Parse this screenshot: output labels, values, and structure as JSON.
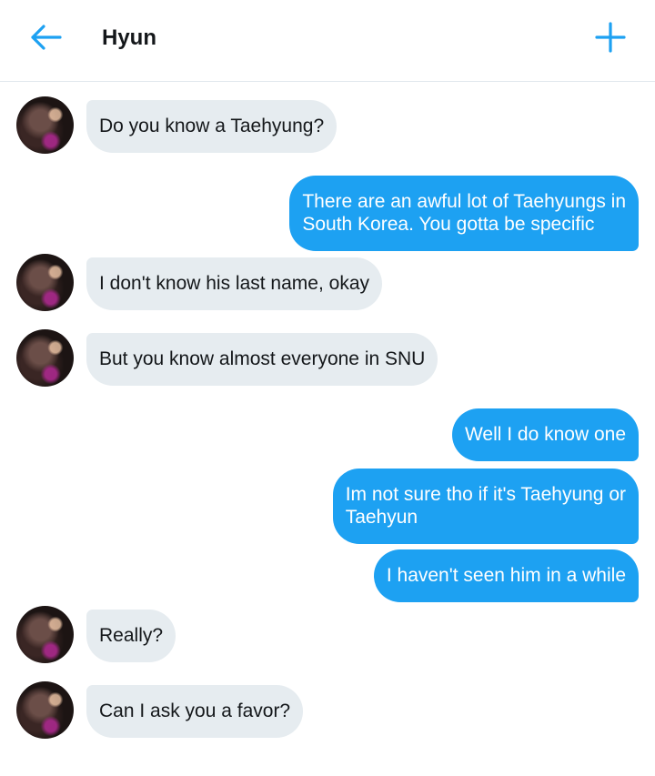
{
  "header": {
    "title": "Hyun",
    "back_icon": "arrow-left-icon",
    "add_icon": "plus-icon",
    "accent_color": "#1da1f2"
  },
  "messages": [
    {
      "direction": "incoming",
      "text": "Do you know a Taehyung?"
    },
    {
      "direction": "outgoing",
      "text": "There are an awful lot of Taehyungs in\nSouth Korea. You gotta be specific"
    },
    {
      "direction": "incoming",
      "text": "I don't know his last name, okay"
    },
    {
      "direction": "incoming",
      "text": "But you know almost everyone in SNU"
    },
    {
      "direction": "outgoing",
      "text": "Well I do know one"
    },
    {
      "direction": "outgoing",
      "text": "Im not sure tho if it's Taehyung or\nTaehyun"
    },
    {
      "direction": "outgoing",
      "text": "I haven't seen him in a while"
    },
    {
      "direction": "incoming",
      "text": "Really?"
    },
    {
      "direction": "incoming",
      "text": "Can I ask you a favor?"
    }
  ],
  "colors": {
    "incoming_bubble": "#e6ecf0",
    "outgoing_bubble": "#1da1f2",
    "divider": "#e1e8ed"
  }
}
